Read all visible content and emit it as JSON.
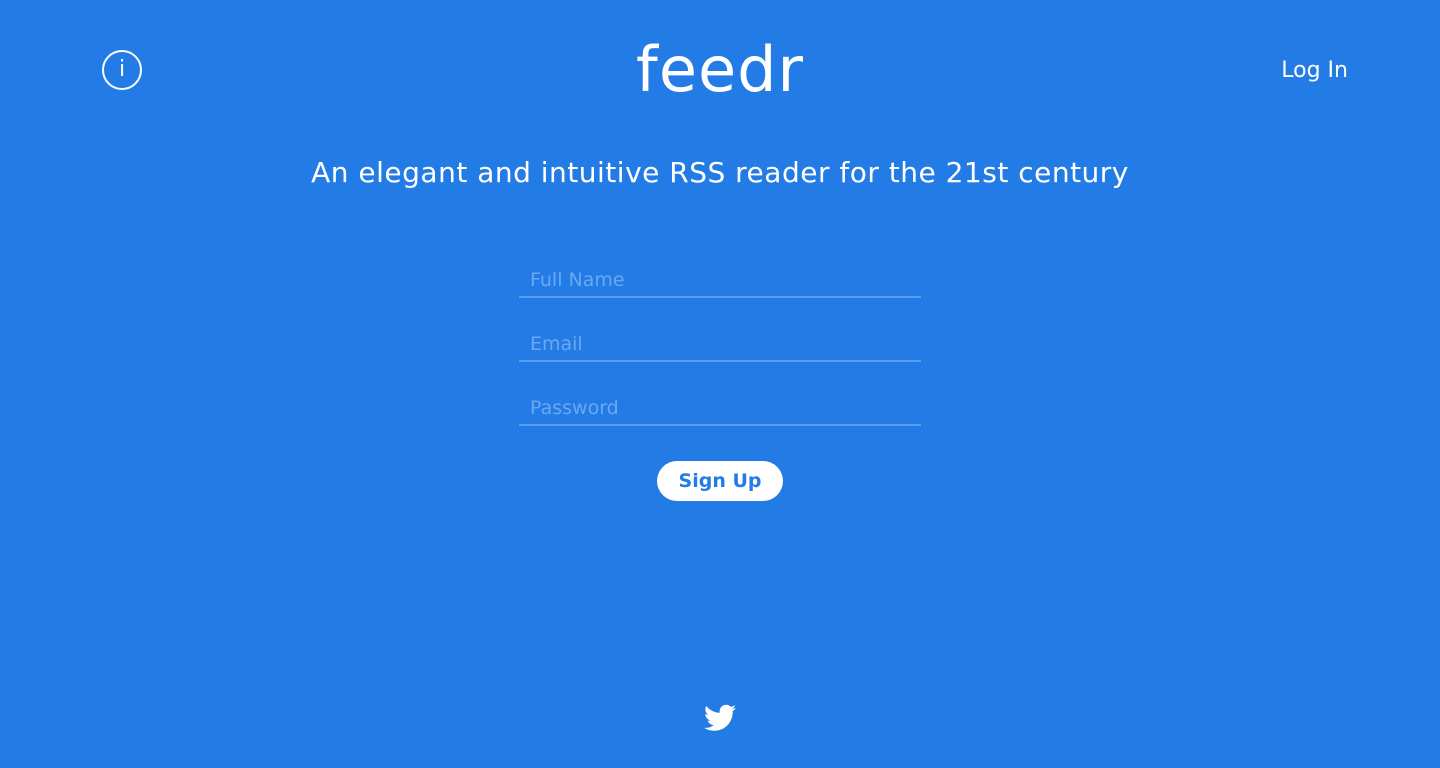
{
  "header": {
    "info_icon_glyph": "i",
    "logo": "feedr",
    "login_label": "Log In"
  },
  "tagline": "An elegant and intuitive RSS reader for the 21st century",
  "form": {
    "full_name_placeholder": "Full Name",
    "email_placeholder": "Email",
    "password_placeholder": "Password",
    "full_name_value": "",
    "email_value": "",
    "password_value": "",
    "signup_label": "Sign Up"
  },
  "footer": {
    "social_icon": "twitter-icon"
  },
  "colors": {
    "background": "#237ce6",
    "text": "#ffffff",
    "placeholder": "#6aa8f2",
    "field_underline": "#5a9df0",
    "button_bg": "#ffffff",
    "button_text": "#237ce6"
  }
}
